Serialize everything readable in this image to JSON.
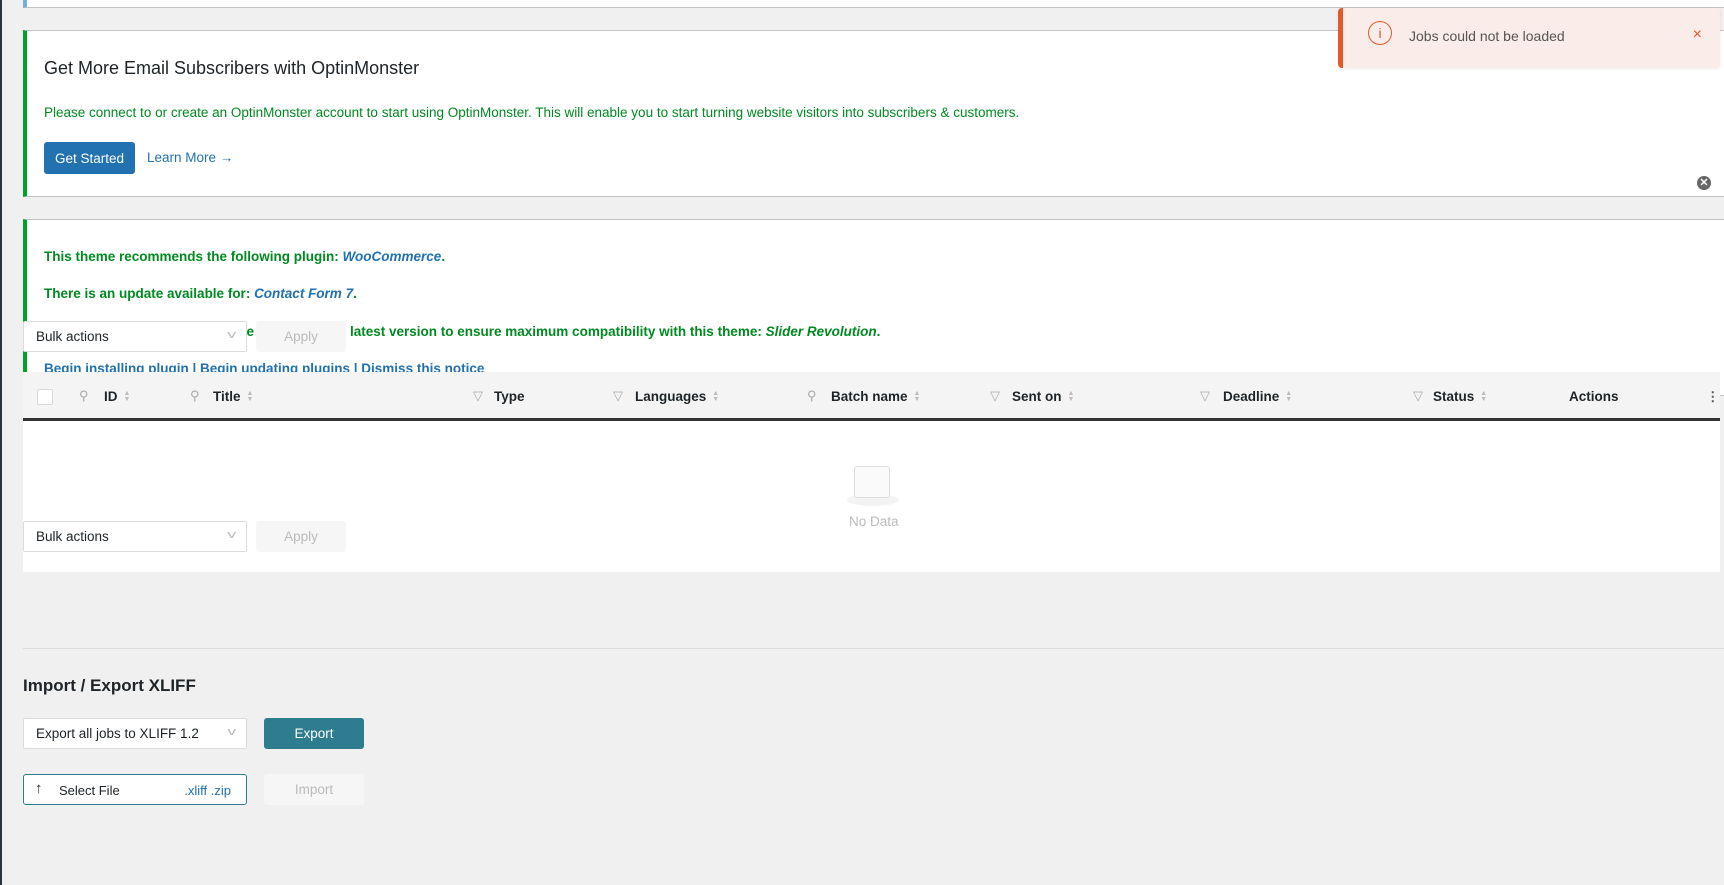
{
  "toast": {
    "message": "Jobs could not be loaded",
    "icon": "info-icon",
    "close": "×",
    "color": "#e05a2b"
  },
  "optin": {
    "title": "Get More Email Subscribers with OptinMonster",
    "text": "Please connect to or create an OptinMonster account to start using OptinMonster. This will enable you to start turning website visitors into subscribers & customers.",
    "get_started": "Get Started",
    "learn_more": "Learn More →"
  },
  "plugin_notice": {
    "line1_prefix": "This theme recommends the following plugin: ",
    "line1_plugin": "WooCommerce",
    "line2_prefix": "There is an update available for: ",
    "line2_plugin": "Contact Form 7",
    "line3_prefix": "The following plugin needs to be updated to its latest version to ensure maximum compatibility with this theme: ",
    "line3_plugin": "Slider Revolution",
    "period": ".",
    "links": [
      "Begin installing plugin",
      "Begin updating plugins",
      "Dismiss this notice"
    ],
    "separator": " | "
  },
  "bulk": {
    "select_value": "Bulk actions",
    "apply": "Apply"
  },
  "table": {
    "columns": [
      {
        "label": "ID",
        "icon": "search"
      },
      {
        "label": "Title",
        "icon": "search"
      },
      {
        "label": "Type",
        "icon": "filter"
      },
      {
        "label": "Languages",
        "icon": "filter"
      },
      {
        "label": "Batch name",
        "icon": "search"
      },
      {
        "label": "Sent on",
        "icon": "filter"
      },
      {
        "label": "Deadline",
        "icon": "filter"
      },
      {
        "label": "Status",
        "icon": "filter"
      },
      {
        "label": "Actions",
        "icon": ""
      }
    ],
    "empty": "No Data"
  },
  "xliff": {
    "heading": "Import / Export XLIFF",
    "export_select": "Export all jobs to XLIFF 1.2",
    "export_button": "Export",
    "select_file": "Select File",
    "file_types": ".xliff .zip",
    "import_button": "Import"
  }
}
